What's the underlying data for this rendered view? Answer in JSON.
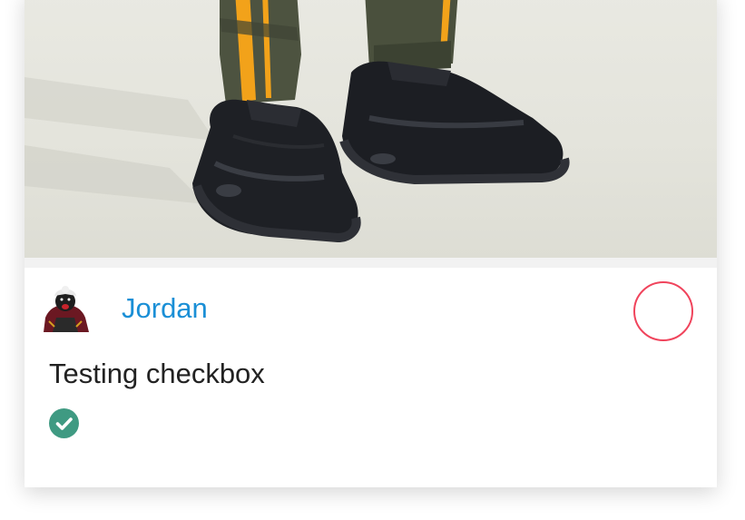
{
  "post": {
    "author": "Jordan",
    "title": "Testing checkbox",
    "image_subject": "sneakers-photo",
    "checked": true
  },
  "colors": {
    "author_link": "#1a8fd6",
    "select_ring": "#f0445c",
    "check_badge": "#3f9a82",
    "text": "#222222"
  },
  "icons": {
    "avatar": "user-avatar",
    "select": "select-circle-icon",
    "check": "check-circle-icon"
  }
}
